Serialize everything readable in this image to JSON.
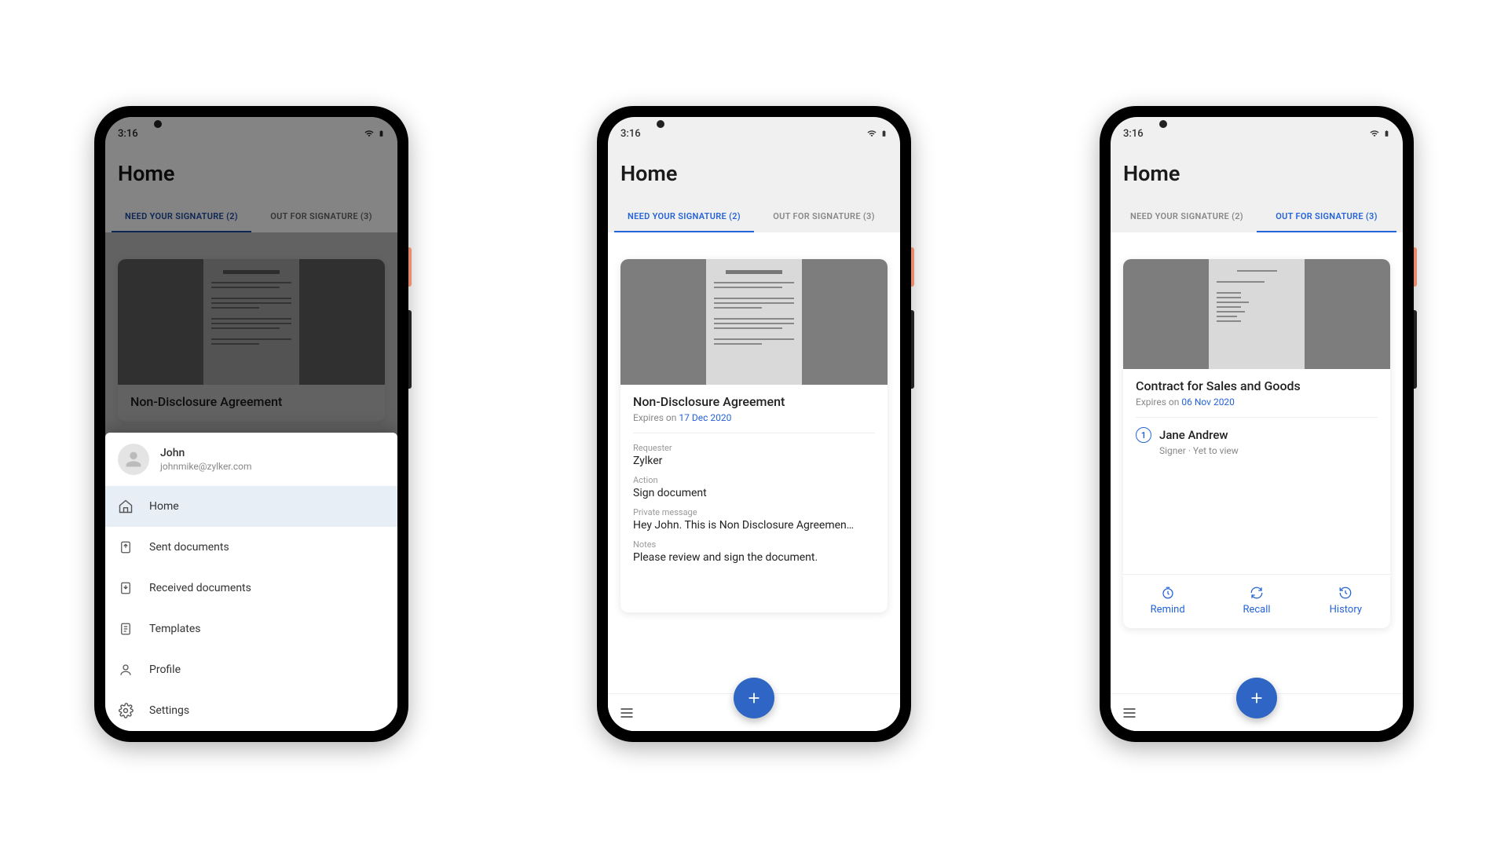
{
  "status": {
    "time": "3:16"
  },
  "home_title": "Home",
  "tabs": {
    "need_signature": "NEED YOUR SIGNATURE (2)",
    "out_for_signature": "OUT FOR SIGNATURE (3)"
  },
  "bottom_sheet": {
    "profile_name": "John",
    "profile_email": "johnmike@zylker.com",
    "items": {
      "home": "Home",
      "sent": "Sent documents",
      "received": "Received documents",
      "templates": "Templates",
      "profile": "Profile",
      "settings": "Settings"
    }
  },
  "phone2": {
    "doc_title": "Non-Disclosure Agreement",
    "expires_prefix": "Expires on ",
    "expires_date": "17 Dec 2020",
    "requester_label": "Requester",
    "requester_value": "Zylker",
    "action_label": "Action",
    "action_value": "Sign document",
    "pm_label": "Private message",
    "pm_value": "Hey John. This is Non Disclosure Agreemen…",
    "notes_label": "Notes",
    "notes_value": "Please review and sign the document."
  },
  "phone3": {
    "doc_title": "Contract for Sales and Goods",
    "expires_prefix": "Expires on ",
    "expires_date": "06 Nov 2020",
    "recipient_order": "1",
    "recipient_name": "Jane Andrew",
    "recipient_meta": "Signer   ·   Yet to view",
    "actions": {
      "remind": "Remind",
      "recall": "Recall",
      "history": "History"
    }
  }
}
